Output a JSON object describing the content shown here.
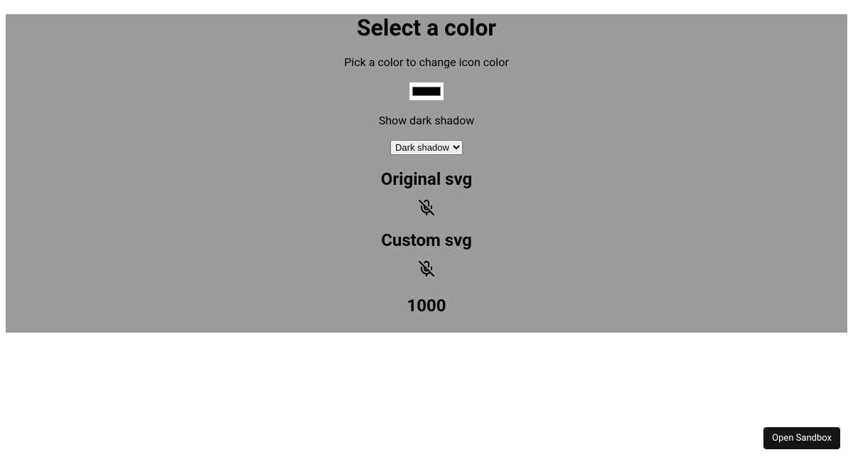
{
  "header": {
    "title": "Select a color",
    "subtitle": "Pick a color to change icon color"
  },
  "color_input": {
    "value": "#000000"
  },
  "shadow": {
    "label": "Show dark shadow",
    "selected": "Dark shadow"
  },
  "sections": {
    "original": "Original svg",
    "custom": "Custom svg"
  },
  "number_value": "1000",
  "footer": {
    "open_sandbox": "Open Sandbox"
  },
  "icon_color": "#000000"
}
